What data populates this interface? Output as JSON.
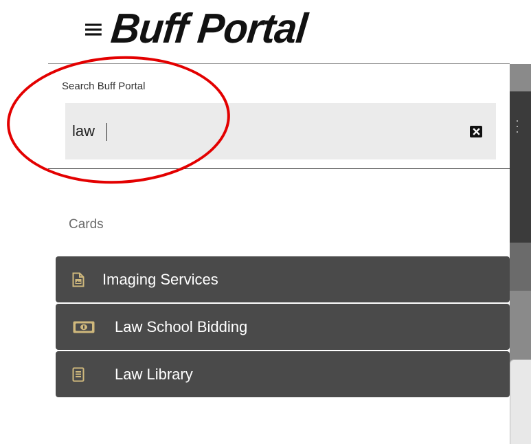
{
  "header": {
    "menu_icon": "hamburger-menu-icon",
    "menu_glyph": "≡",
    "logo_text": "Buff Portal"
  },
  "search": {
    "label": "Search Buff Portal",
    "value": "law",
    "clear_icon": "close-icon"
  },
  "results": {
    "section_label": "Cards",
    "cards": [
      {
        "label": "Imaging Services",
        "icon": "document-image-icon"
      },
      {
        "label": "Law School Bidding",
        "icon": "money-bill-icon"
      },
      {
        "label": "Law Library",
        "icon": "book-icon"
      }
    ]
  },
  "colors": {
    "annotation": "#e30000",
    "card_background": "#4a4a4a",
    "icon_accent": "#cfb87c",
    "search_background": "#ebebeb"
  }
}
